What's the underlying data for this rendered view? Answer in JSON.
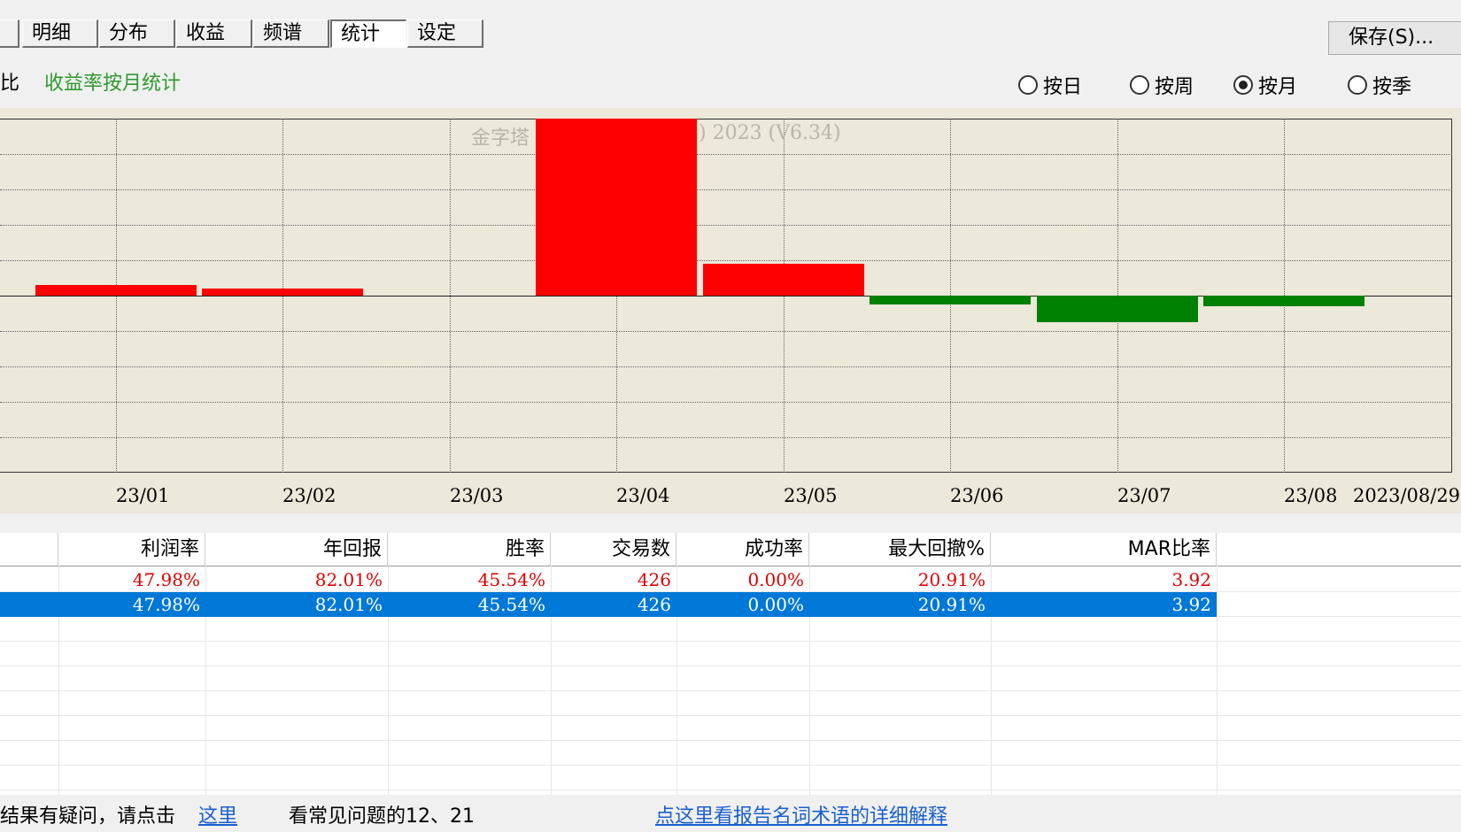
{
  "tabs": [
    "",
    "明细",
    "分布",
    "收益",
    "频谱",
    "统计",
    "设定"
  ],
  "active_tab": "统计",
  "save_label": "保存(S)...",
  "subtitle": {
    "left": "比",
    "main": "收益率按月统计",
    "main_color": "#2e9a2e"
  },
  "radios": [
    {
      "label": "按日",
      "checked": false
    },
    {
      "label": "按周",
      "checked": false
    },
    {
      "label": "按月",
      "checked": true
    },
    {
      "label": "按季",
      "checked": false
    }
  ],
  "chart": {
    "watermark_left": "金字塔",
    "watermark_right": "4) 2023 (V6.34)",
    "x_labels": [
      "23/01",
      "23/02",
      "23/03",
      "23/04",
      "23/05",
      "23/06",
      "23/07",
      "23/08",
      "2023/08/29"
    ]
  },
  "chart_data": {
    "type": "bar",
    "categories": [
      "23/01",
      "23/02",
      "23/03",
      "23/04",
      "23/05",
      "23/06",
      "23/07",
      "23/08"
    ],
    "values": [
      0.3,
      0.2,
      0,
      5.0,
      0.9,
      -0.25,
      -0.75,
      -0.3
    ],
    "positive_color": "#ff0000",
    "negative_color": "#008000",
    "ylim": [
      -5.0,
      5.0
    ],
    "grid": true
  },
  "table": {
    "headers": [
      "利润率",
      "年回报",
      "胜率",
      "交易数",
      "成功率",
      "最大回撤%",
      "MAR比率"
    ],
    "rows": [
      {
        "values": [
          "47.98%",
          "82.01%",
          "45.54%",
          "426",
          "0.00%",
          "20.91%",
          "3.92"
        ],
        "selected": false
      },
      {
        "values": [
          "47.98%",
          "82.01%",
          "45.54%",
          "426",
          "0.00%",
          "20.91%",
          "3.92"
        ],
        "selected": true
      }
    ]
  },
  "footer": {
    "text1": "结果有疑问，请点击",
    "link1": "这里",
    "text2": "看常见问题的12、21",
    "link2": "点这里看报告名词术语的详细解释"
  }
}
